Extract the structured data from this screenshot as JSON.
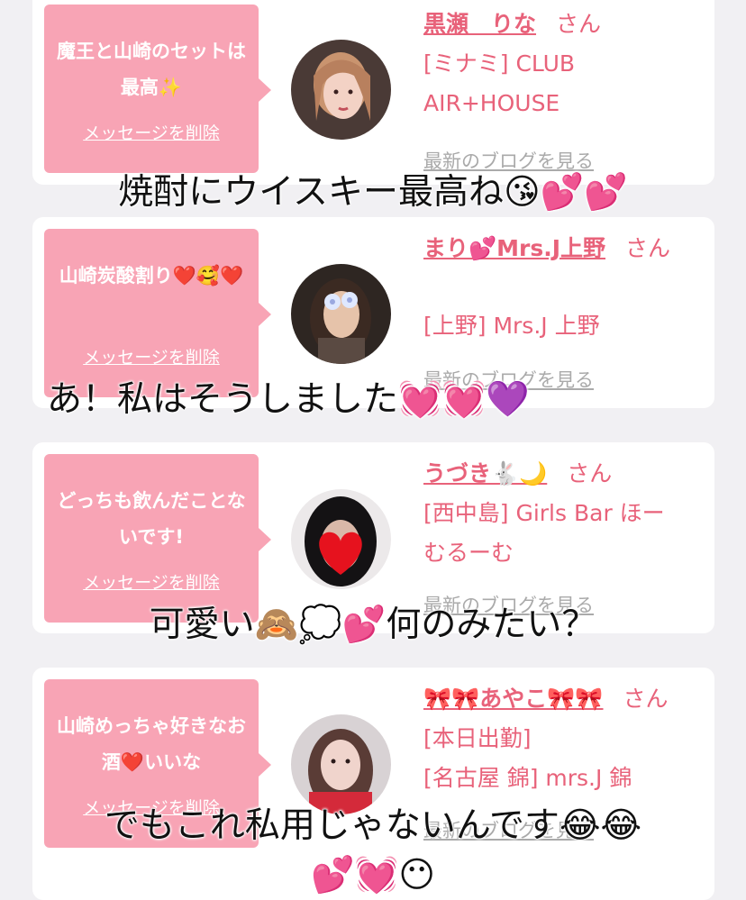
{
  "cards": [
    {
      "message": "魔王と山崎のセットは最高✨",
      "delete_label": "メッセージを削除",
      "name": "黒瀬　りな",
      "san": "さん",
      "shop_lines": [
        "[ミナミ] CLUB",
        "AIR+HOUSE"
      ],
      "blog_label": "最新のブログを見る",
      "avatar_icon": "woman-photo-icon"
    },
    {
      "message": "山崎炭酸割り❤️🥰❤️",
      "delete_label": "メッセージを削除",
      "name": "まり💕Mrs.J上野",
      "san": "さん",
      "shop_lines": [
        "[上野] Mrs.J 上野"
      ],
      "blog_label": "最新のブログを見る",
      "avatar_icon": "woman-photo-icon"
    },
    {
      "message": "どっちも飲んだことないです!",
      "delete_label": "メッセージを削除",
      "name": "うづき🐇🌙",
      "san": "さん",
      "shop_lines": [
        "[西中島] Girls Bar ほー",
        "むるーむ"
      ],
      "blog_label": "最新のブログを見る",
      "avatar_icon": "woman-photo-icon"
    },
    {
      "message": "山崎めっちゃ好きなお酒❤️いいな",
      "delete_label": "メッセージを削除",
      "name": "🎀🎀あやこ🎀🎀",
      "san": "さん",
      "shop_lines": [
        "[本日出勤]",
        "[名古屋 錦] mrs.J 錦"
      ],
      "blog_label": "最新のブログを見る",
      "avatar_icon": "woman-photo-icon"
    }
  ],
  "overlays": [
    "焼酎にウイスキー最高ね😘💕💕",
    "あ！私はそうしました💓💓💜",
    "可愛い🙈💭💕何のみたい？",
    "でもこれ私用じゃないんです😂😂",
    "💕💓😶"
  ],
  "colors": {
    "bubble": "#f8a4b5",
    "name": "#e8627a",
    "background": "#f1f0f3"
  }
}
